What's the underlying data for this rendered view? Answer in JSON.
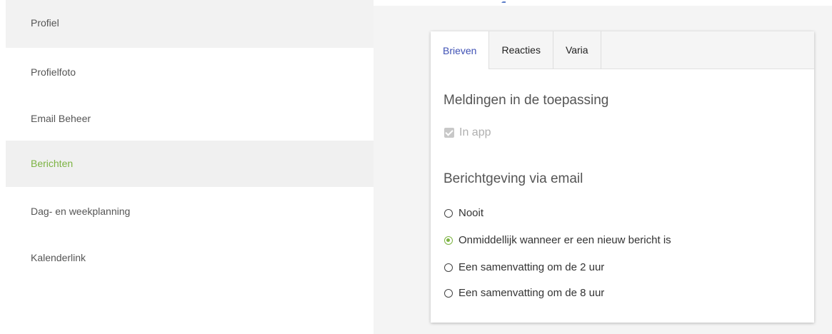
{
  "sidebar": {
    "items": [
      {
        "label": "Profiel"
      },
      {
        "label": "Profielfoto"
      },
      {
        "label": "Email Beheer"
      },
      {
        "label": "Berichten"
      },
      {
        "label": "Dag- en weekplanning"
      },
      {
        "label": "Kalenderlink"
      }
    ],
    "active_color": "#7cb342"
  },
  "tabs": [
    {
      "label": "Brieven"
    },
    {
      "label": "Reacties"
    },
    {
      "label": "Varia"
    }
  ],
  "active_tab": "Brieven",
  "notifications": {
    "title": "Meldingen in de toepassing",
    "in_app_label": "In app",
    "in_app_checked": true
  },
  "email": {
    "title": "Berichtgeving via email",
    "options": [
      {
        "label": "Nooit",
        "selected": false
      },
      {
        "label": "Onmiddellijk wanneer er een nieuw bericht is",
        "selected": true
      },
      {
        "label": "Een samenvatting om de 2 uur",
        "selected": false
      },
      {
        "label": "Een samenvatting om de 8 uur",
        "selected": false
      }
    ]
  },
  "colors": {
    "accent_green": "#7cb342",
    "tab_active": "#3f51b5"
  }
}
